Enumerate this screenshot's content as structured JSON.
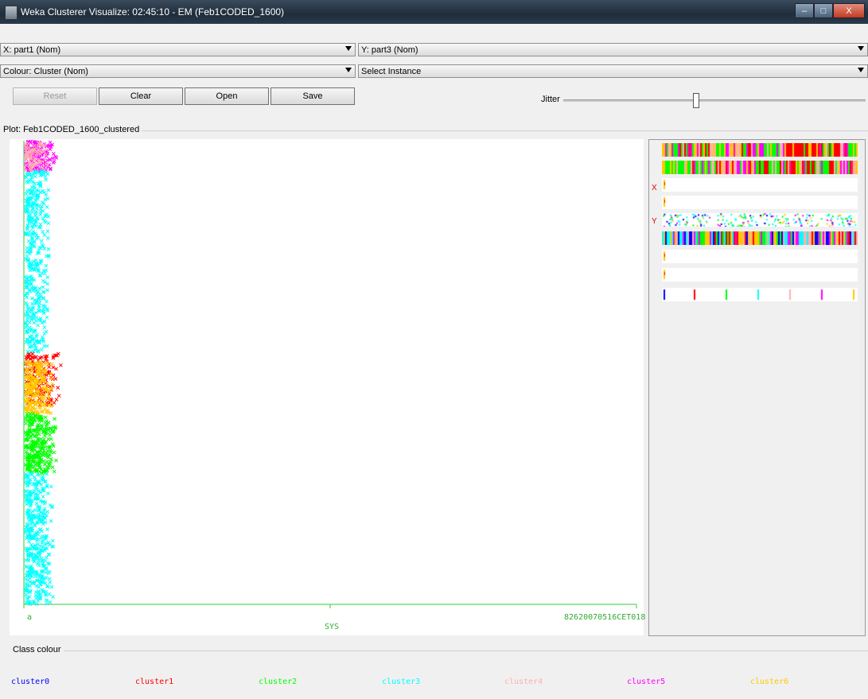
{
  "window": {
    "title": "Weka Clusterer Visualize: 02:45:10 - EM (Feb1CODED_1600)",
    "controls": {
      "minimize": "–",
      "maximize": "□",
      "close": "X"
    }
  },
  "axes": {
    "x_select": "X: part1 (Nom)",
    "y_select": "Y: part3 (Nom)",
    "colour_select": "Colour: Cluster (Nom)",
    "instance_select": "Select Instance"
  },
  "buttons": {
    "reset": "Reset",
    "clear": "Clear",
    "open": "Open",
    "save": "Save"
  },
  "jitter": {
    "label": "Jitter",
    "level": 0.43
  },
  "plot": {
    "title": "Plot: Feb1CODED_1600_clustered",
    "x_tick_left": "a",
    "x_tick_right": "82620070516CET018",
    "x_axis_label": "SYS"
  },
  "attribute_panel": {
    "x_marker": "X",
    "y_marker": "Y"
  },
  "class_colour": {
    "label": "Class colour",
    "clusters": [
      {
        "name": "cluster0",
        "color": "#0000ff"
      },
      {
        "name": "cluster1",
        "color": "#ff0000"
      },
      {
        "name": "cluster2",
        "color": "#00ff00"
      },
      {
        "name": "cluster3",
        "color": "#00ffff"
      },
      {
        "name": "cluster4",
        "color": "#ffafaf"
      },
      {
        "name": "cluster5",
        "color": "#ff00ff"
      },
      {
        "name": "cluster6",
        "color": "#ffc800"
      }
    ]
  }
}
